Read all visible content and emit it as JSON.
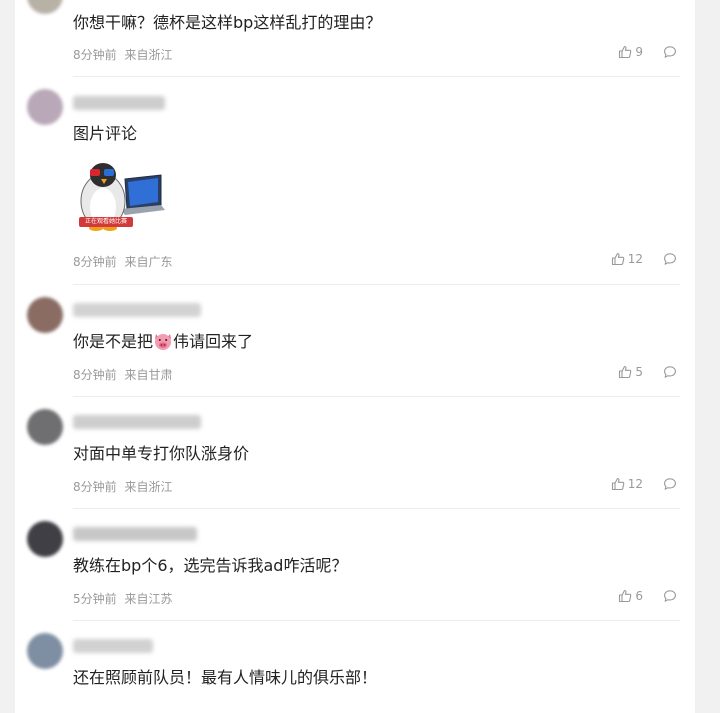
{
  "comments": [
    {
      "text": "你想干嘛？德杯是这样bp这样乱打的理由？",
      "time": "8分钟前",
      "location": "来自浙江",
      "likes": "9",
      "avatar_color": "#b8b1a6",
      "name_color": "#c9c9c9"
    },
    {
      "text": "图片评论",
      "time": "8分钟前",
      "location": "来自广东",
      "likes": "12",
      "avatar_color": "#b9a9b8",
      "name_color": "#bdbdbd",
      "sticker_caption": "正在观看她比赛"
    },
    {
      "text_before": "你是不是把",
      "text_after": "伟请回来了",
      "emoji": "pig-face-icon",
      "time": "8分钟前",
      "location": "来自甘肃",
      "likes": "5",
      "avatar_color": "#8a6c63",
      "name_color": "#c4c4c4"
    },
    {
      "text": "对面中单专打你队涨身价",
      "time": "8分钟前",
      "location": "来自浙江",
      "likes": "12",
      "avatar_color": "#6f6f72",
      "name_color": "#bdbdbd"
    },
    {
      "text": "教练在bp个6，选完告诉我ad咋活呢？",
      "time": "5分钟前",
      "location": "来自江苏",
      "likes": "6",
      "avatar_color": "#3f3f45",
      "name_color": "#b5b5b5"
    },
    {
      "text": "还在照顾前队员！最有人情味儿的俱乐部！",
      "avatar_color": "#7f8fa3",
      "name_color": "#c2c2c2"
    }
  ],
  "colors": {
    "background": "#f1f1f1",
    "panel": "#ffffff",
    "meta_text": "#999999",
    "divider": "#ececec"
  }
}
